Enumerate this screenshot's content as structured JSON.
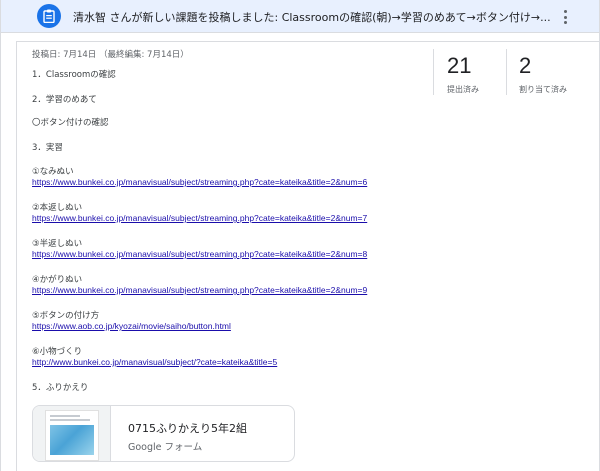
{
  "header": {
    "icon": "assignment-icon",
    "title": "清水智 さんが新しい課題を投稿しました: Classroomの確認(朝)→学習のめあて→ボタン付け→..."
  },
  "post": {
    "posted_info": "投稿日: 7月14日 （最終編集: 7月14日）",
    "stats": [
      {
        "number": "21",
        "label": "提出済み"
      },
      {
        "number": "2",
        "label": "割り当て済み"
      }
    ],
    "body_lines": [
      "1．Classroomの確認",
      "2．学習のめあて",
      "〇ボタン付けの確認",
      "3．実習"
    ],
    "items": [
      {
        "label": "①なみぬい",
        "url": "https://www.bunkei.co.jp/manavisual/subject/streaming.php?cate=kateika&title=2&num=6"
      },
      {
        "label": "②本返しぬい",
        "url": "https://www.bunkei.co.jp/manavisual/subject/streaming.php?cate=kateika&title=2&num=7"
      },
      {
        "label": "③半返しぬい",
        "url": "https://www.bunkei.co.jp/manavisual/subject/streaming.php?cate=kateika&title=2&num=8"
      },
      {
        "label": "④かがりぬい",
        "url": "https://www.bunkei.co.jp/manavisual/subject/streaming.php?cate=kateika&title=2&num=9"
      },
      {
        "label": "⑤ボタンの付け方",
        "url": "https://www.aob.co.jp/kyozai/movie/saiho/button.html"
      },
      {
        "label": "⑥小物づくり",
        "url": "http://www.bunkei.co.jp/manavisual/subject/?cate=kateika&title=5"
      }
    ],
    "closing": "5．ふりかえり",
    "attachment": {
      "title": "0715ふりかえり5年2組",
      "type": "Google フォーム"
    }
  }
}
